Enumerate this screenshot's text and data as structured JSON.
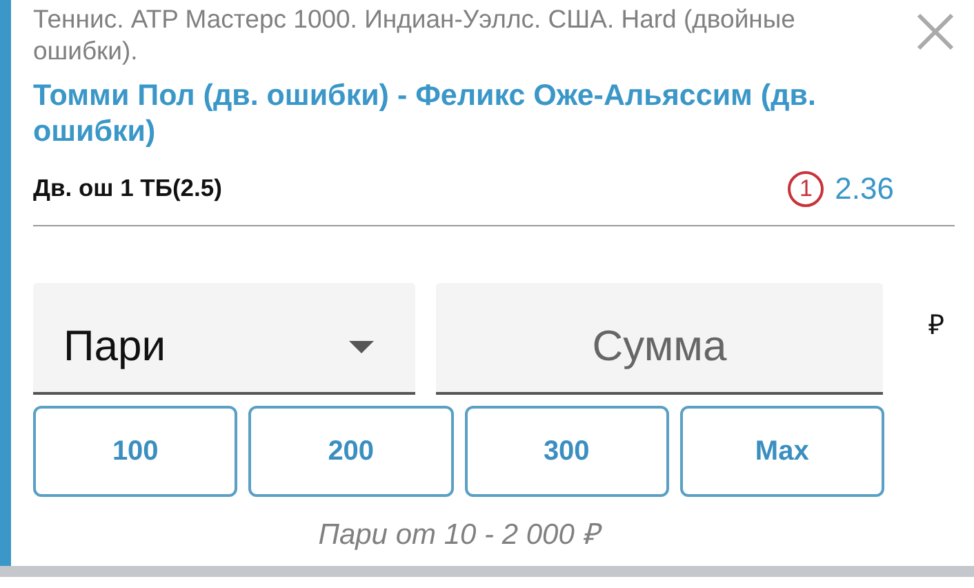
{
  "event": {
    "title": "Теннис. ATP Мастерс 1000. Индиан-Уэллс. США. Hard (двойные ошибки).",
    "match": "Томми Пол (дв. ошибки) - Феликс Оже-Альяссим (дв. ошибки)"
  },
  "bet": {
    "label": "Дв. ош 1 ТБ(2.5)",
    "marker": "1",
    "odds": "2.36"
  },
  "stake": {
    "type_value": "Пари",
    "amount_placeholder": "Сумма",
    "currency": "₽"
  },
  "quick_amounts": [
    "100",
    "200",
    "300",
    "Max"
  ],
  "limits": "Пари от 10 - 2 000 ₽"
}
